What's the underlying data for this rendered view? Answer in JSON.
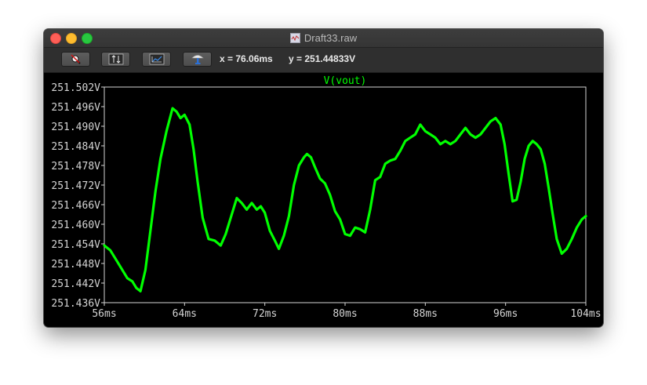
{
  "window": {
    "title": "Draft33.raw"
  },
  "toolbar": {
    "buttons": [
      {
        "name": "zoom-full-button",
        "icon": "zoom-full-icon"
      },
      {
        "name": "autorange-y-button",
        "icon": "autorange-y-icon"
      },
      {
        "name": "zoom-back-button",
        "icon": "zoom-back-icon"
      },
      {
        "name": "probe-button",
        "icon": "probe-icon"
      }
    ],
    "x_readout": "x = 76.06ms",
    "y_readout": "y = 251.44833V"
  },
  "colors": {
    "trace": "#00ff00",
    "axis": "#d4d4d4",
    "background": "#000000"
  },
  "chart_data": {
    "type": "line",
    "title": "V(vout)",
    "xlabel": "",
    "ylabel": "",
    "xlim": [
      56,
      104
    ],
    "ylim": [
      251.436,
      251.502
    ],
    "x_ticks": [
      "56ms",
      "64ms",
      "72ms",
      "80ms",
      "88ms",
      "96ms",
      "104ms"
    ],
    "y_ticks": [
      "251.502V",
      "251.496V",
      "251.490V",
      "251.484V",
      "251.478V",
      "251.472V",
      "251.466V",
      "251.460V",
      "251.454V",
      "251.448V",
      "251.442V",
      "251.436V"
    ],
    "grid": false,
    "series": [
      {
        "name": "V(vout)",
        "color": "#00ff00",
        "x": [
          56,
          56.6,
          57.2,
          57.8,
          58.3,
          58.8,
          59.2,
          59.6,
          60.1,
          60.6,
          61.1,
          61.6,
          62.2,
          62.8,
          63.2,
          63.6,
          64.0,
          64.5,
          64.9,
          65.3,
          65.8,
          66.4,
          67.0,
          67.6,
          68.1,
          68.6,
          69.2,
          69.7,
          70.2,
          70.7,
          71.2,
          71.6,
          72.0,
          72.5,
          73.0,
          73.4,
          73.9,
          74.4,
          74.9,
          75.4,
          75.9,
          76.2,
          76.6,
          77.0,
          77.5,
          78.0,
          78.5,
          79.0,
          79.5,
          80.0,
          80.5,
          81.0,
          81.5,
          82.0,
          82.5,
          83.0,
          83.5,
          84.0,
          84.5,
          85.0,
          85.5,
          86.0,
          86.5,
          87.0,
          87.5,
          88.0,
          88.5,
          89.0,
          89.5,
          90.0,
          90.5,
          91.0,
          91.5,
          92.0,
          92.5,
          93.0,
          93.5,
          94.0,
          94.5,
          95.0,
          95.5,
          95.9,
          96.3,
          96.7,
          97.1,
          97.5,
          97.9,
          98.3,
          98.7,
          99.1,
          99.5,
          99.9,
          100.3,
          100.7,
          101.1,
          101.6,
          102.1,
          102.6,
          103.1,
          103.6,
          104.0
        ],
        "values": [
          251.4535,
          251.452,
          251.449,
          251.446,
          251.4435,
          251.4425,
          251.4405,
          251.4395,
          251.446,
          251.458,
          251.47,
          251.48,
          251.4885,
          251.4955,
          251.4945,
          251.4925,
          251.4935,
          251.4905,
          251.483,
          251.473,
          251.462,
          251.4555,
          251.455,
          251.4535,
          251.457,
          251.462,
          251.468,
          251.4665,
          251.4645,
          251.4665,
          251.4645,
          251.4655,
          251.4635,
          251.458,
          251.455,
          251.4525,
          251.4565,
          251.4625,
          251.472,
          251.478,
          251.4805,
          251.4815,
          251.4805,
          251.4775,
          251.474,
          251.4725,
          251.469,
          251.464,
          251.4615,
          251.457,
          251.4565,
          251.459,
          251.4585,
          251.4575,
          251.4645,
          251.4735,
          251.4745,
          251.4785,
          251.4795,
          251.48,
          251.4825,
          251.4855,
          251.4865,
          251.4875,
          251.4905,
          251.4885,
          251.4875,
          251.4865,
          251.4845,
          251.4855,
          251.4845,
          251.4855,
          251.4875,
          251.4895,
          251.4875,
          251.4865,
          251.4875,
          251.4895,
          251.4915,
          251.4925,
          251.4905,
          251.4845,
          251.4755,
          251.467,
          251.4675,
          251.473,
          251.48,
          251.484,
          251.4855,
          251.4845,
          251.483,
          251.4785,
          251.471,
          251.463,
          251.4555,
          251.451,
          251.4525,
          251.4555,
          251.459,
          251.4615,
          251.4625
        ]
      }
    ]
  }
}
